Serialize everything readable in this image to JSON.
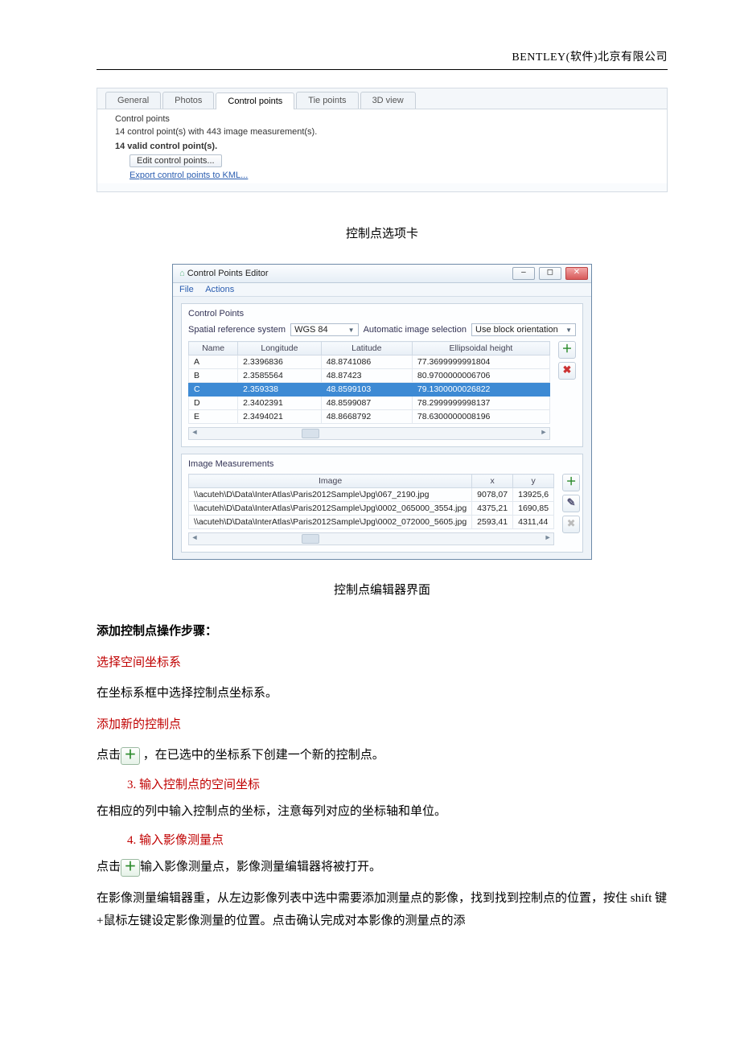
{
  "doc_header": "BENTLEY(软件)北京有限公司",
  "shot1": {
    "tabs": [
      "General",
      "Photos",
      "Control points",
      "Tie points",
      "3D view"
    ],
    "active_tab_index": 2,
    "fieldset_title": "Control points",
    "summary": "14 control point(s) with 443 image measurement(s).",
    "valid_line": "14 valid control point(s).",
    "edit_button": "Edit control points...",
    "export_link": "Export control points to KML..."
  },
  "caption1": "控制点选项卡",
  "shot2": {
    "window_title": "Control Points Editor",
    "menu": [
      "File",
      "Actions"
    ],
    "panel1_title": "Control Points",
    "srs_label": "Spatial reference system",
    "srs_value": "WGS 84",
    "ais_label": "Automatic image selection",
    "ais_value": "Use block orientation",
    "cp_headers": [
      "Name",
      "Longitude",
      "Latitude",
      "Ellipsoidal height"
    ],
    "cp_rows": [
      {
        "n": "A",
        "lon": "2.3396836",
        "lat": "48.8741086",
        "h": "77.3699999991804"
      },
      {
        "n": "B",
        "lon": "2.3585564",
        "lat": "48.87423",
        "h": "80.9700000006706"
      },
      {
        "n": "C",
        "lon": "2.359338",
        "lat": "48.8599103",
        "h": "79.1300000026822",
        "sel": true
      },
      {
        "n": "D",
        "lon": "2.3402391",
        "lat": "48.8599087",
        "h": "78.2999999998137"
      },
      {
        "n": "E",
        "lon": "2.3494021",
        "lat": "48.8668792",
        "h": "78.6300000008196"
      }
    ],
    "panel2_title": "Image Measurements",
    "im_headers": [
      "Image",
      "x",
      "y"
    ],
    "im_rows": [
      {
        "img": "\\\\acuteh\\D\\Data\\InterAtlas\\Paris2012Sample\\Jpg\\067_2190.jpg",
        "x": "9078,07",
        "y": "13925,6"
      },
      {
        "img": "\\\\acuteh\\D\\Data\\InterAtlas\\Paris2012Sample\\Jpg\\0002_065000_3554.jpg",
        "x": "4375,21",
        "y": "1690,85"
      },
      {
        "img": "\\\\acuteh\\D\\Data\\InterAtlas\\Paris2012Sample\\Jpg\\0002_072000_5605.jpg",
        "x": "2593,41",
        "y": "4311,44"
      }
    ]
  },
  "caption2": "控制点编辑器界面",
  "body": {
    "heading": "添加控制点操作步骤：",
    "step1_title": "选择空间坐标系",
    "step1_text": "在坐标系框中选择控制点坐标系。",
    "step2_title": "添加新的控制点",
    "step2_pre": "点击",
    "step2_post": "，在已选中的坐标系下创建一个新的控制点。",
    "step3_li": "3.  输入控制点的空间坐标",
    "step3_text": "在相应的列中输入控制点的坐标，注意每列对应的坐标轴和单位。",
    "step4_li": "4.  输入影像测量点",
    "step4_pre": "点击",
    "step4_post": "输入影像测量点，影像测量编辑器将被打开。",
    "para5": "在影像测量编辑器重，从左边影像列表中选中需要添加测量点的影像，找到找到控制点的位置，按住 shift 键+鼠标左键设定影像测量的位置。点击确认完成对本影像的测量点的添"
  }
}
